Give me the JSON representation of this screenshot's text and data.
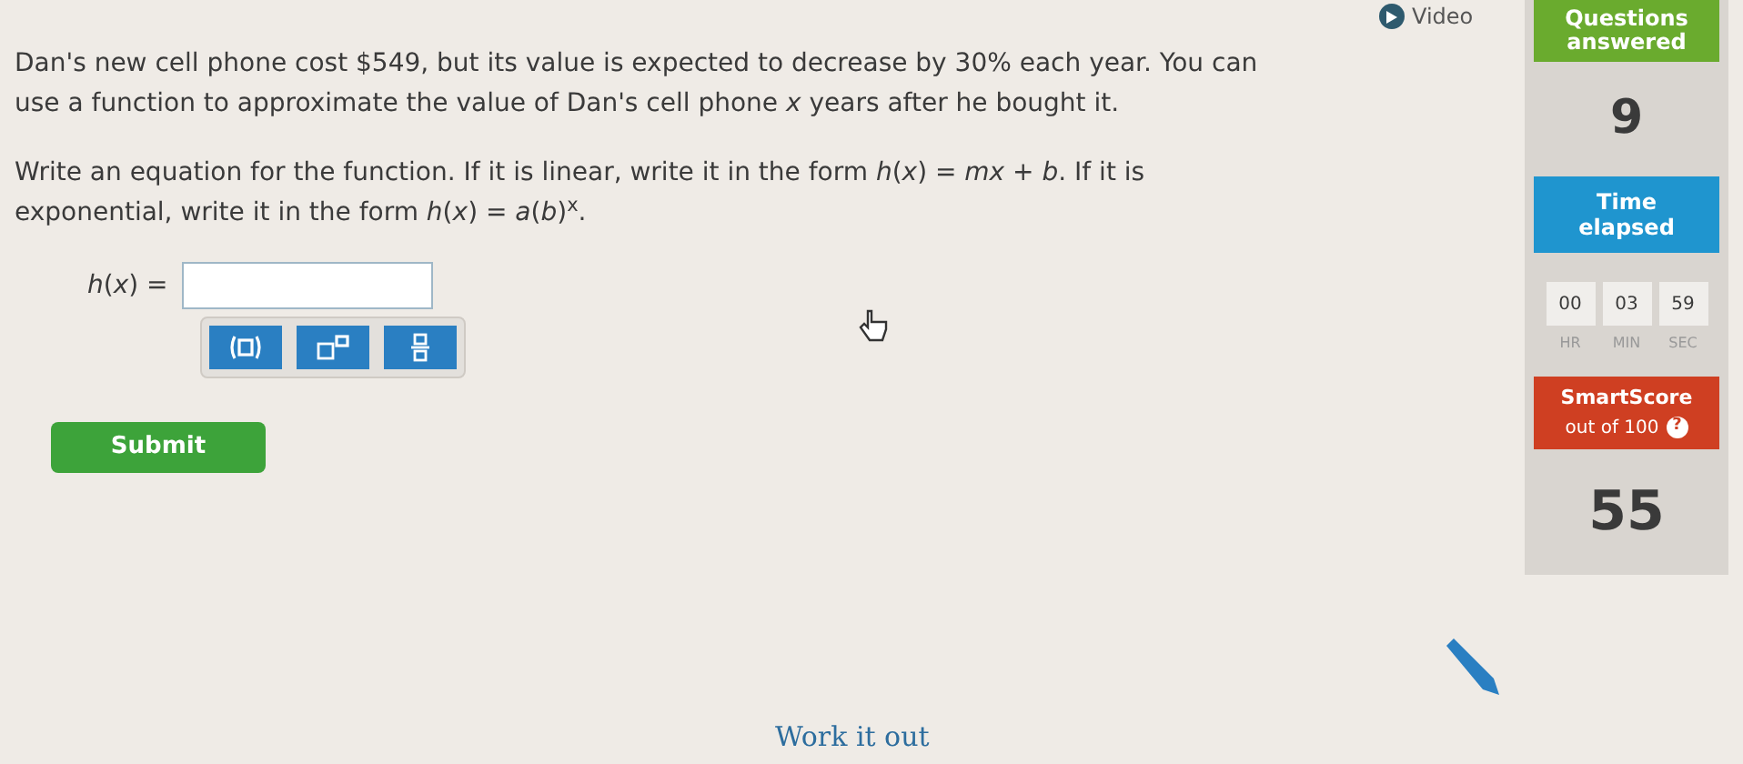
{
  "question": {
    "paragraphs": [
      "Dan's new cell phone cost $549, but its value is expected to decrease by 30% each year. You can use a function to approximate the value of Dan's cell phone *x* years after he bought it.",
      "Write an equation for the function. If it is linear, write it in the form *h*(*x*) = *mx* + *b*. If it is exponential, write it in the form *h*(*x*) = *a*(*b*)$^{x}$."
    ]
  },
  "answer": {
    "label": "*h*(*x*) ="
  },
  "keypad": [
    {
      "kind": "parentheses"
    },
    {
      "kind": "exponent"
    },
    {
      "kind": "fraction"
    }
  ],
  "submit": "Submit",
  "video": "Video",
  "questions_answered": {
    "title": "Questions answered",
    "value": "9"
  },
  "time_elapsed": {
    "title": "Time elapsed",
    "units": [
      {
        "value": "00",
        "label": "HR"
      },
      {
        "value": "03",
        "label": "MIN"
      },
      {
        "value": "59",
        "label": "SEC"
      }
    ]
  },
  "smartscore": {
    "title": "SmartScore",
    "subtitle": "out of 100",
    "help": "?",
    "value": "55"
  },
  "work_it_out": "Work it out"
}
